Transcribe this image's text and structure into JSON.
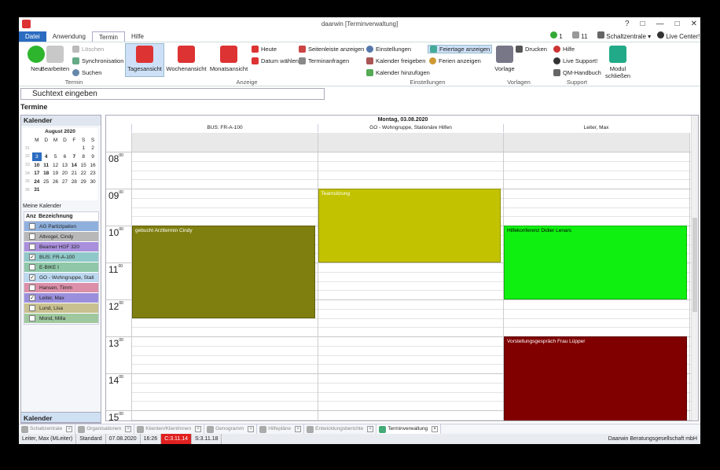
{
  "title": "daarwin [Terminverwaltung]",
  "window_controls": [
    "?",
    "□",
    "—",
    "□",
    "✕"
  ],
  "ribbon_tabs": [
    "Datei",
    "Anwendung",
    "Termin",
    "Hilfe"
  ],
  "ribbon_right": {
    "count1": "1",
    "count2": "11",
    "schaltzentrale": "Schaltzentrale",
    "live_center": "Live Center!"
  },
  "ribbon": {
    "neu": "Neu",
    "bearbeiten": "Bearbeiten",
    "loeschen": "Löschen",
    "sync": "Synchronisation",
    "suchen": "Suchen",
    "tagesansicht": "Tagesansicht",
    "wochenansicht": "Wochenansicht",
    "monatsansicht": "Monatsansicht",
    "heute": "Heute",
    "datum_waehlen": "Datum wählen",
    "seitenleiste": "Seitenleiste anzeigen",
    "terminanfragen": "Terminanfragen",
    "einstellungen": "Einstellungen",
    "kal_freigeben": "Kalender freigeben",
    "kal_hinzu": "Kalender hinzufügen",
    "feiertage": "Feiertage anzeigen",
    "ferien": "Ferien anzeigen",
    "vorlage": "Vorlage",
    "drucken": "Drucken",
    "hilfe": "Hilfe",
    "live_support": "Live Support!",
    "qm": "QM-Handbuch",
    "modul": "Modul",
    "schliessen": "schließen",
    "grp_termin": "Termin",
    "grp_anzeige": "Anzeige",
    "grp_einst": "Einstellungen",
    "grp_vorlagen": "Vorlagen",
    "grp_support": "Support"
  },
  "search": {
    "placeholder": "Suchtext eingeben"
  },
  "section_title": "Termine",
  "sidebar": {
    "kalender": "Kalender",
    "month": "August 2020",
    "weekdays": [
      "M",
      "D",
      "M",
      "D",
      "F",
      "S",
      "S"
    ],
    "weeks": [
      {
        "wk": "31",
        "days": [
          "",
          "",
          "",
          "",
          "",
          "1",
          "2"
        ]
      },
      {
        "wk": "32",
        "days": [
          "3",
          "4",
          "5",
          "6",
          "7",
          "8",
          "9"
        ]
      },
      {
        "wk": "33",
        "days": [
          "10",
          "11",
          "12",
          "13",
          "14",
          "15",
          "16"
        ]
      },
      {
        "wk": "34",
        "days": [
          "17",
          "18",
          "19",
          "20",
          "21",
          "22",
          "23"
        ]
      },
      {
        "wk": "35",
        "days": [
          "24",
          "25",
          "26",
          "27",
          "28",
          "29",
          "30"
        ]
      },
      {
        "wk": "36",
        "days": [
          "31",
          "",
          "",
          "",
          "",
          "",
          ""
        ]
      }
    ],
    "meine_kalender": "Meine Kalender",
    "col_anz": "Anz",
    "col_bez": "Bezeichnung",
    "calendars": [
      {
        "name": "AG Partizipation",
        "color": "#8fb0dc",
        "checked": false
      },
      {
        "name": "Altvogel, Cindy",
        "color": "#b8b8b8",
        "checked": false
      },
      {
        "name": "Beamer HGF 320",
        "color": "#a98fdc",
        "checked": false
      },
      {
        "name": "BUS: FR-A-100",
        "color": "#8fc8c8",
        "checked": true
      },
      {
        "name": "E-BIKE I",
        "color": "#8fc8a8",
        "checked": false
      },
      {
        "name": "GO - Wohngruppe, Stati",
        "color": "#bcd8f0",
        "checked": true
      },
      {
        "name": "Hansen, Timm",
        "color": "#dc8fa8",
        "checked": false
      },
      {
        "name": "Leiter, Max",
        "color": "#9a8fdc",
        "checked": true
      },
      {
        "name": "Lund, Lisa",
        "color": "#c8c08f",
        "checked": false
      },
      {
        "name": "Mond, Milla",
        "color": "#9fc89f",
        "checked": false
      }
    ],
    "footer": "Kalender"
  },
  "schedule": {
    "date": "Montag, 03.08.2020",
    "columns": [
      "BUS: FR-A-100",
      "GO - Wohngruppe, Stationäre Hilfen",
      "Leiter, Max"
    ],
    "hours": [
      "08",
      "09",
      "10",
      "11",
      "12",
      "13",
      "14",
      "15"
    ],
    "minutes_label": "00",
    "appointments": [
      {
        "title": "gebucht Arzttermin Cindy",
        "col": 0,
        "start": 10.0,
        "end": 12.5,
        "color": "#7f7f10"
      },
      {
        "title": "Teamsitzung",
        "col": 1,
        "start": 9.0,
        "end": 11.0,
        "color": "#c2c200"
      },
      {
        "title": "Hilfekonferenz Didier Lenars",
        "col": 2,
        "start": 10.0,
        "end": 12.0,
        "color": "#10f010"
      },
      {
        "title": "Vorstellungsgespräch Frau Lüpper",
        "col": 2,
        "start": 13.0,
        "end": 15.5,
        "color": "#800000"
      }
    ]
  },
  "bottom_tabs": [
    "Schaltzentrale",
    "Organisationen",
    "Klienten/KlientInnen",
    "Genogramm",
    "Hilfepläne",
    "Entwicklungsberichte",
    "Terminverwaltung"
  ],
  "status": {
    "user": "Leiter, Max (MLeiter)",
    "profile": "Standard",
    "date": "07.08.2020",
    "time": "16:26",
    "c_ver": "C:3.11.14",
    "s_ver": "S:3.11.18",
    "company": "Daarwin Beratungsgesellschaft mbH"
  }
}
